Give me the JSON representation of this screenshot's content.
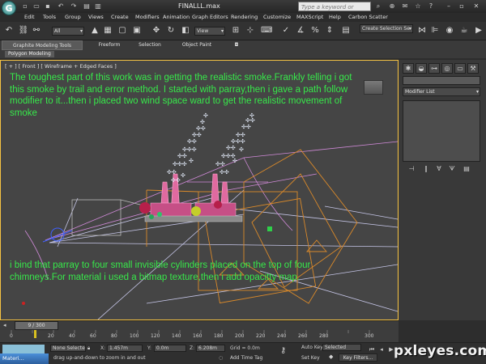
{
  "titlebar": {
    "app_logo": "G",
    "doc_title": "FINALLL.max",
    "search_placeholder": "Type a keyword or phrase"
  },
  "menubar": {
    "items": [
      "Edit",
      "Tools",
      "Group",
      "Views",
      "Create",
      "Modifiers",
      "Animation",
      "Graph Editors",
      "Rendering",
      "Customize",
      "MAXScript",
      "Help",
      "Carbon Scatter"
    ]
  },
  "toolbar": {
    "filter_dropdown": "All",
    "ref_coord_dropdown": "View",
    "selection_set_dropdown": "Create Selection Se"
  },
  "ribbon": {
    "tabs": [
      "Graphite Modeling Tools",
      "Freeform",
      "Selection",
      "Object Paint"
    ],
    "sub_label": "Polygon Modeling"
  },
  "viewport": {
    "label": "[ + ] [ Front ] [ Wireframe + Edged Faces ]",
    "note_top": "The toughest part of this work was in getting the realistic smoke.Frankly telling i got this smoke by trail and error method. I started with parray,then i gave a path follow modifier to it...then i placed two wind space ward to get the realistic movement of smoke",
    "note_bottom": "i bind that parray to four small invisible cylinders placed on the top of four chimneys.For material i used a bitmap texture,then i add opacitty map."
  },
  "command_panel": {
    "modifier_list": "Modifier List"
  },
  "timeline": {
    "frame_display": "9 / 300",
    "ticks": [
      "0",
      "20",
      "40",
      "60",
      "80",
      "100",
      "120",
      "140",
      "160",
      "180",
      "200",
      "220",
      "240",
      "260",
      "280",
      "300"
    ]
  },
  "statusbar": {
    "taskbar_item": "Materi...",
    "selection_status": "None Selecte",
    "prompt": "drag up-and-down to zoom in and out",
    "x_label": "X:",
    "x_value": "1.457m",
    "y_label": "Y:",
    "y_value": "0.0m",
    "z_label": "Z:",
    "z_value": "6.208m",
    "grid": "Grid = 0.0m",
    "add_time_tag": "Add Time Tag",
    "auto_key": "Auto Key",
    "selected_dropdown": "Selected",
    "set_key": "Set Key",
    "key_filters": "Key Filters..."
  },
  "watermark": "pxleyes.com",
  "colors": {
    "note_text": "#37e84a",
    "viewport_border": "#f6c343",
    "viewport_bg": "#454545"
  }
}
